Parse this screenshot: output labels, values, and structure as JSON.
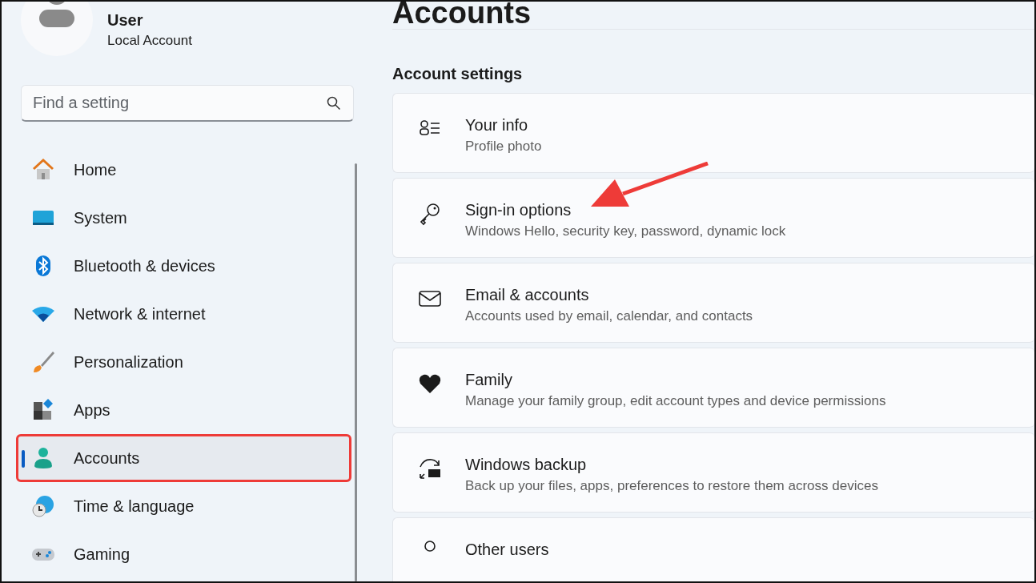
{
  "user": {
    "name": "User",
    "account_type": "Local Account"
  },
  "search": {
    "placeholder": "Find a setting"
  },
  "nav": [
    {
      "label": "Home",
      "selected": false,
      "highlighted": false
    },
    {
      "label": "System",
      "selected": false,
      "highlighted": false
    },
    {
      "label": "Bluetooth & devices",
      "selected": false,
      "highlighted": false
    },
    {
      "label": "Network & internet",
      "selected": false,
      "highlighted": false
    },
    {
      "label": "Personalization",
      "selected": false,
      "highlighted": false
    },
    {
      "label": "Apps",
      "selected": false,
      "highlighted": false
    },
    {
      "label": "Accounts",
      "selected": true,
      "highlighted": true
    },
    {
      "label": "Time & language",
      "selected": false,
      "highlighted": false
    },
    {
      "label": "Gaming",
      "selected": false,
      "highlighted": false
    }
  ],
  "page_title": "Accounts",
  "section_title": "Account settings",
  "cards": [
    {
      "title": "Your info",
      "subtitle": "Profile photo",
      "pointed": false
    },
    {
      "title": "Sign-in options",
      "subtitle": "Windows Hello, security key, password, dynamic lock",
      "pointed": true
    },
    {
      "title": "Email & accounts",
      "subtitle": "Accounts used by email, calendar, and contacts",
      "pointed": false
    },
    {
      "title": "Family",
      "subtitle": "Manage your family group, edit account types and device permissions",
      "pointed": false
    },
    {
      "title": "Windows backup",
      "subtitle": "Back up your files, apps, preferences to restore them across devices",
      "pointed": false
    },
    {
      "title": "Other users",
      "pointed": false
    }
  ]
}
